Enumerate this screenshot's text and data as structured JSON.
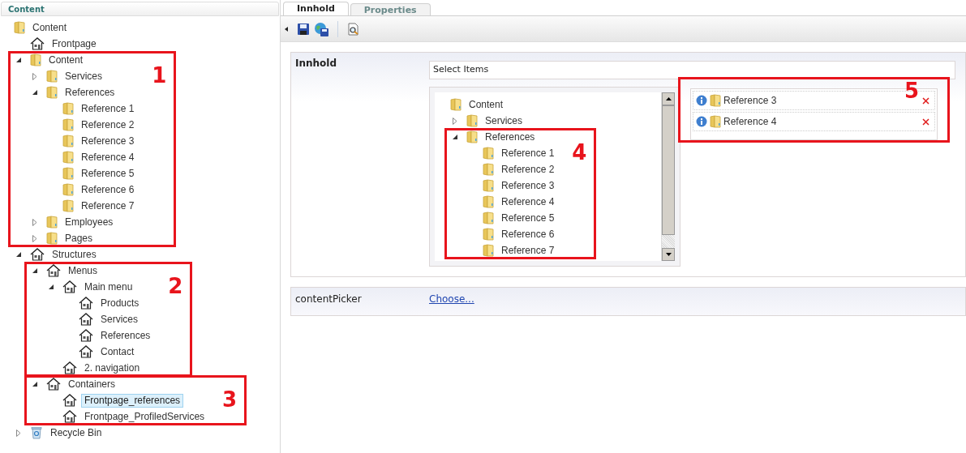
{
  "left_panel": {
    "title": "Content",
    "tree": [
      {
        "label": "Content",
        "kind": "folder",
        "selected": false,
        "children": [
          {
            "label": "Frontpage",
            "kind": "house",
            "selected": false
          },
          {
            "label": "Content",
            "kind": "folder",
            "expanded": true,
            "selected": false,
            "annotation": "1",
            "children": [
              {
                "label": "Services",
                "kind": "folder",
                "expanded": false,
                "selected": false
              },
              {
                "label": "References",
                "kind": "folder",
                "expanded": true,
                "selected": false,
                "children": [
                  {
                    "label": "Reference 1",
                    "kind": "folder",
                    "selected": false
                  },
                  {
                    "label": "Reference 2",
                    "kind": "folder",
                    "selected": false
                  },
                  {
                    "label": "Reference 3",
                    "kind": "folder",
                    "selected": false
                  },
                  {
                    "label": "Reference 4",
                    "kind": "folder",
                    "selected": false
                  },
                  {
                    "label": "Reference 5",
                    "kind": "folder",
                    "selected": false
                  },
                  {
                    "label": "Reference 6",
                    "kind": "folder",
                    "selected": false
                  },
                  {
                    "label": "Reference 7",
                    "kind": "folder",
                    "selected": false
                  }
                ]
              },
              {
                "label": "Employees",
                "kind": "folder",
                "expanded": false,
                "selected": false
              },
              {
                "label": "Pages",
                "kind": "folder",
                "expanded": false,
                "selected": false
              }
            ]
          },
          {
            "label": "Structures",
            "kind": "house",
            "expanded": true,
            "selected": false,
            "children": [
              {
                "label": "Menus",
                "kind": "house",
                "expanded": true,
                "selected": false,
                "annotation": "2",
                "children": [
                  {
                    "label": "Main menu",
                    "kind": "house",
                    "expanded": true,
                    "selected": false,
                    "children": [
                      {
                        "label": "Products",
                        "kind": "house",
                        "selected": false
                      },
                      {
                        "label": "Services",
                        "kind": "house",
                        "selected": false
                      },
                      {
                        "label": "References",
                        "kind": "house",
                        "selected": false
                      },
                      {
                        "label": "Contact",
                        "kind": "house",
                        "selected": false
                      }
                    ]
                  },
                  {
                    "label": "2. navigation",
                    "kind": "house",
                    "selected": false
                  }
                ]
              },
              {
                "label": "Containers",
                "kind": "house",
                "expanded": true,
                "selected": false,
                "annotation": "3",
                "children": [
                  {
                    "label": "Frontpage_references",
                    "kind": "house",
                    "selected": true
                  },
                  {
                    "label": "Frontpage_ProfiledServices",
                    "kind": "house",
                    "selected": false
                  }
                ]
              }
            ]
          },
          {
            "label": "Recycle Bin",
            "kind": "bin",
            "expanded": false,
            "selected": false
          }
        ]
      }
    ]
  },
  "tabs": [
    {
      "label": "Innhold",
      "selected": true
    },
    {
      "label": "Properties",
      "selected": false
    }
  ],
  "toolbar": [
    {
      "kind": "collapse"
    },
    {
      "kind": "save"
    },
    {
      "kind": "save-publish"
    },
    {
      "kind": "separator"
    },
    {
      "kind": "preview"
    }
  ],
  "properties": [
    {
      "kind": "picker",
      "label": "Innhold",
      "header": "Select Items",
      "tree": [
        {
          "label": "Content",
          "kind": "folder",
          "selected": false,
          "children": [
            {
              "label": "Services",
              "kind": "folder",
              "expanded": false,
              "selected": false
            },
            {
              "label": "References",
              "kind": "folder",
              "expanded": true,
              "selected": false,
              "annotation": "4",
              "children": [
                {
                  "label": "Reference 1",
                  "kind": "folder",
                  "selected": false
                },
                {
                  "label": "Reference 2",
                  "kind": "folder",
                  "selected": false
                },
                {
                  "label": "Reference 3",
                  "kind": "folder",
                  "selected": false
                },
                {
                  "label": "Reference 4",
                  "kind": "folder",
                  "selected": false
                },
                {
                  "label": "Reference 5",
                  "kind": "folder",
                  "selected": false
                },
                {
                  "label": "Reference 6",
                  "kind": "folder",
                  "selected": false
                },
                {
                  "label": "Reference 7",
                  "kind": "folder",
                  "selected": false
                }
              ]
            }
          ]
        }
      ],
      "selected_items": {
        "annotation": "5",
        "items": [
          {
            "label": "Reference 3",
            "kind": "folder"
          },
          {
            "label": "Reference 4",
            "kind": "folder"
          }
        ]
      }
    },
    {
      "kind": "link",
      "label": "contentPicker",
      "link": "Choose..."
    }
  ]
}
